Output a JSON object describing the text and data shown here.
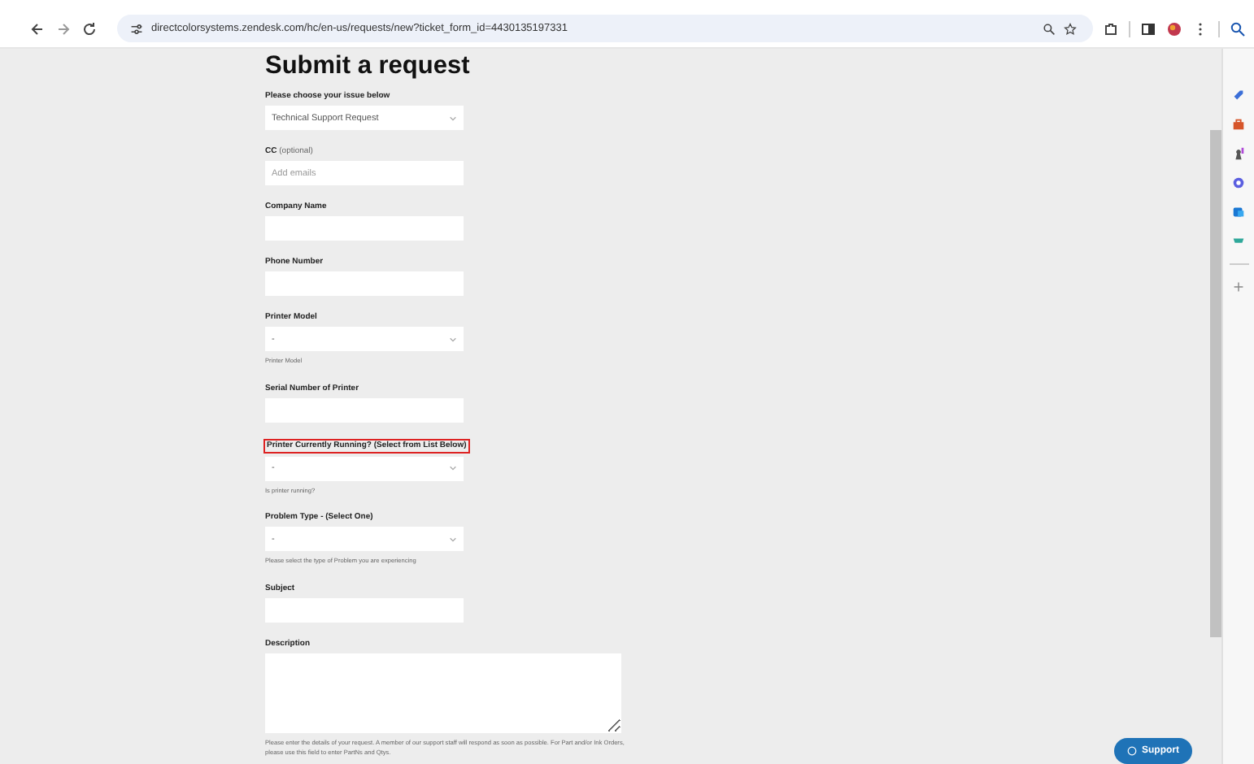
{
  "browser": {
    "url": "directcolorsystems.zendesk.com/hc/en-us/requests/new?ticket_form_id=4430135197331"
  },
  "page": {
    "title": "Submit a request"
  },
  "fields": [
    {
      "kind": "select",
      "label": "Please choose your issue below",
      "value": "Technical Support Request",
      "highlighted": false
    },
    {
      "kind": "input",
      "label": "CC",
      "note": "(optional)",
      "placeholder": "Add emails",
      "highlighted": false
    },
    {
      "kind": "input",
      "label": "Company Name",
      "highlighted": false
    },
    {
      "kind": "input",
      "label": "Phone Number",
      "highlighted": false
    },
    {
      "kind": "select",
      "label": "Printer Model",
      "value": "-",
      "help": "Printer Model",
      "highlighted": false
    },
    {
      "kind": "input",
      "label": "Serial Number of Printer",
      "highlighted": false
    },
    {
      "kind": "select",
      "label": "Printer Currently Running? (Select from List Below)",
      "value": "-",
      "help": "Is printer running?",
      "highlighted": true
    },
    {
      "kind": "select",
      "label": "Problem Type - (Select One)",
      "value": "-",
      "help": "Please select the type of Problem you are experiencing",
      "highlighted": false
    },
    {
      "kind": "input",
      "label": "Subject",
      "highlighted": false
    },
    {
      "kind": "textarea",
      "label": "Description",
      "help": "Please enter the details of your request. A member of our support staff will respond as soon as possible. For Part and/or Ink Orders, please use this field to enter PartNs and Qtys.",
      "highlighted": false
    }
  ],
  "support_button": {
    "label": "Support"
  }
}
